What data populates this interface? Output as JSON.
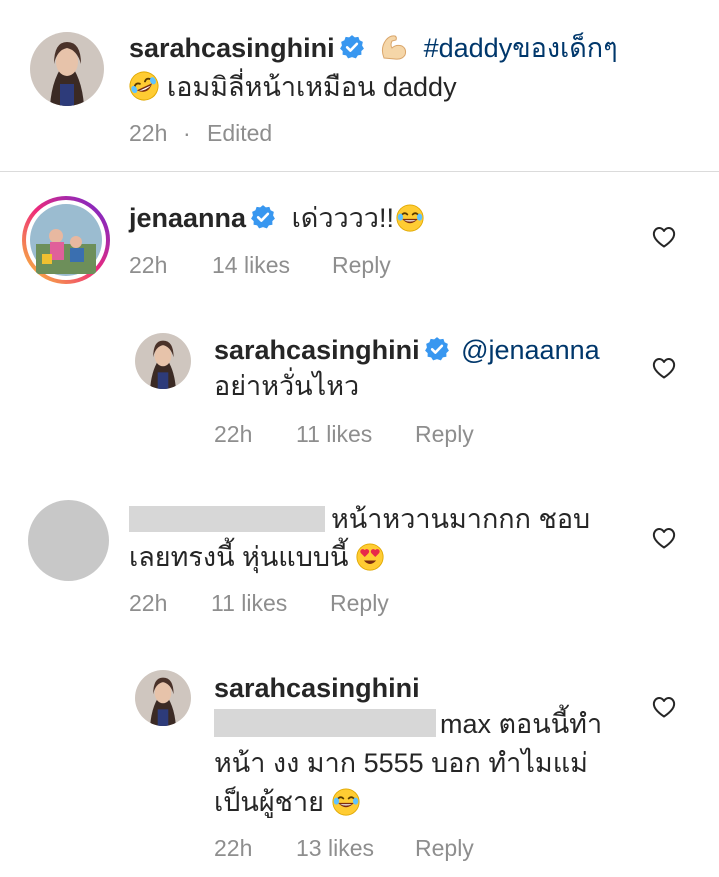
{
  "caption": {
    "username": "sarahcasinghini",
    "hashtag": "#daddyของเด็กๆ",
    "line2": "เอมมิลี่หน้าเหมือน daddy",
    "time": "22h",
    "separator": "·",
    "edited": "Edited"
  },
  "comments": [
    {
      "username": "jenaanna",
      "text": "เด่วววว!!",
      "time": "22h",
      "likes": "14 likes",
      "reply": "Reply"
    },
    {
      "username": "sarahcasinghini",
      "mention": "@jenaanna",
      "text": "อย่าหวั่นไหว",
      "time": "22h",
      "likes": "11 likes",
      "reply": "Reply"
    },
    {
      "text_line1": "หน้าหวานมากกก ชอบ",
      "text_line2": "เลยทรงนี้ หุ่นแบบนี้",
      "time": "22h",
      "likes": "11 likes",
      "reply": "Reply"
    },
    {
      "username": "sarahcasinghini",
      "text_line1": "max ตอนนี้ทำ",
      "text_line2": "หน้า งง มาก 5555 บอก ทำไมแม่",
      "text_line3": "เป็นผู้ชาย",
      "time": "22h",
      "likes": "13 likes",
      "reply": "Reply"
    }
  ],
  "icons": [
    "verified-badge-icon",
    "flexed-biceps-emoji",
    "rolling-laughing-emoji",
    "tears-of-joy-emoji",
    "heart-eyes-emoji",
    "heart-outline-icon"
  ],
  "colors": {
    "verified": "#3897f0",
    "link": "#00376b",
    "meta": "#8e8e8e",
    "divider": "#dbdbdb"
  }
}
